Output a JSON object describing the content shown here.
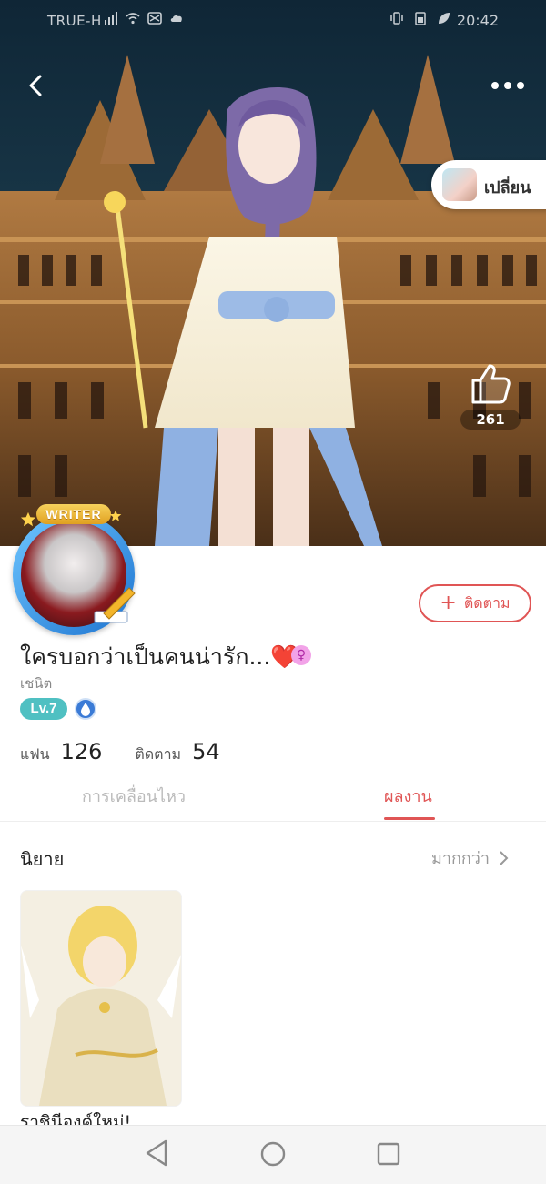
{
  "status_bar": {
    "carrier": "TRUE-H",
    "time": "20:42"
  },
  "header": {
    "change_label": "เปลี่ยน",
    "like_count": "261"
  },
  "profile": {
    "writer_tag": "WRITER",
    "follow_label": "ติดตาม",
    "name": "ใครบอกว่าเป็นคนน่ารัก...",
    "name_emoji": "❤️",
    "gender_symbol": "♀",
    "subtitle": "เชนิต",
    "level": "Lv.7",
    "fans_label": "แฟน",
    "fans_count": "126",
    "following_label": "ติดตาม",
    "following_count": "54"
  },
  "tabs": [
    {
      "label": "การเคลื่อนไหว",
      "active": false
    },
    {
      "label": "ผลงาน",
      "active": true
    }
  ],
  "section": {
    "title": "นิยาย",
    "more_label": "มากกว่า"
  },
  "works": [
    {
      "title": "ราชินีองค์ใหม่!"
    }
  ],
  "colors": {
    "accent": "#e05555",
    "level_badge": "#4fc0c2",
    "muted_text": "#999999"
  }
}
